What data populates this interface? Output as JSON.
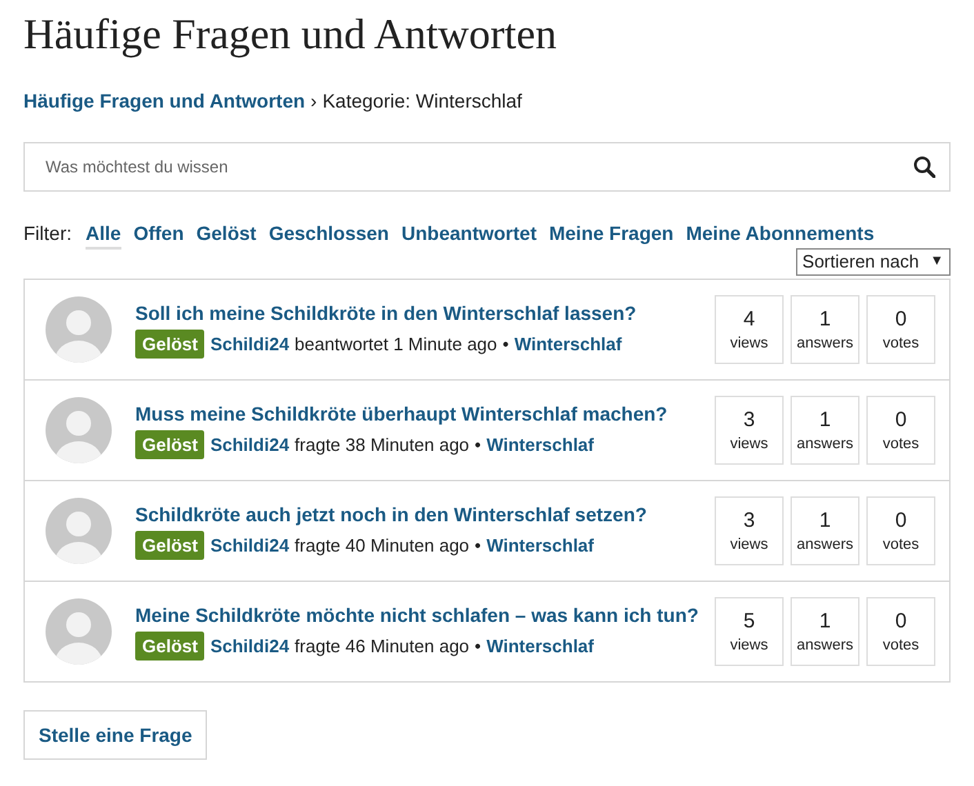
{
  "title": "Häufige Fragen und Antworten",
  "breadcrumb": {
    "link": "Häufige Fragen und Antworten",
    "separator": "›",
    "current": "Kategorie: Winterschlaf"
  },
  "search": {
    "placeholder": "Was möchtest du wissen"
  },
  "filter": {
    "label": "Filter:",
    "items": [
      {
        "label": "Alle",
        "selected": true
      },
      {
        "label": "Offen",
        "selected": false
      },
      {
        "label": "Gelöst",
        "selected": false
      },
      {
        "label": "Geschlossen",
        "selected": false
      },
      {
        "label": "Unbeantwortet",
        "selected": false
      },
      {
        "label": "Meine Fragen",
        "selected": false
      },
      {
        "label": "Meine Abonnements",
        "selected": false
      }
    ]
  },
  "sort": {
    "label": "Sortieren nach",
    "caret": "▼"
  },
  "questions": [
    {
      "title": "Soll ich meine Schildkröte in den Winterschlaf lassen?",
      "status": "Gelöst",
      "author": "Schildi24",
      "action": "beantwortet 1 Minute ago",
      "separator": "•",
      "category": "Winterschlaf",
      "stats": [
        {
          "value": "4",
          "label": "views"
        },
        {
          "value": "1",
          "label": "answers"
        },
        {
          "value": "0",
          "label": "votes"
        }
      ]
    },
    {
      "title": "Muss meine Schildkröte überhaupt Winterschlaf machen?",
      "status": "Gelöst",
      "author": "Schildi24",
      "action": "fragte 38 Minuten ago",
      "separator": "•",
      "category": "Winterschlaf",
      "stats": [
        {
          "value": "3",
          "label": "views"
        },
        {
          "value": "1",
          "label": "answers"
        },
        {
          "value": "0",
          "label": "votes"
        }
      ]
    },
    {
      "title": "Schildkröte auch jetzt noch in den Winterschlaf setzen?",
      "status": "Gelöst",
      "author": "Schildi24",
      "action": "fragte 40 Minuten ago",
      "separator": "•",
      "category": "Winterschlaf",
      "stats": [
        {
          "value": "3",
          "label": "views"
        },
        {
          "value": "1",
          "label": "answers"
        },
        {
          "value": "0",
          "label": "votes"
        }
      ]
    },
    {
      "title": "Meine Schildkröte möchte nicht schlafen – was kann ich tun?",
      "status": "Gelöst",
      "author": "Schildi24",
      "action": "fragte 46 Minuten ago",
      "separator": "•",
      "category": "Winterschlaf",
      "stats": [
        {
          "value": "5",
          "label": "views"
        },
        {
          "value": "1",
          "label": "answers"
        },
        {
          "value": "0",
          "label": "votes"
        }
      ]
    }
  ],
  "ask_button": "Stelle eine Frage"
}
